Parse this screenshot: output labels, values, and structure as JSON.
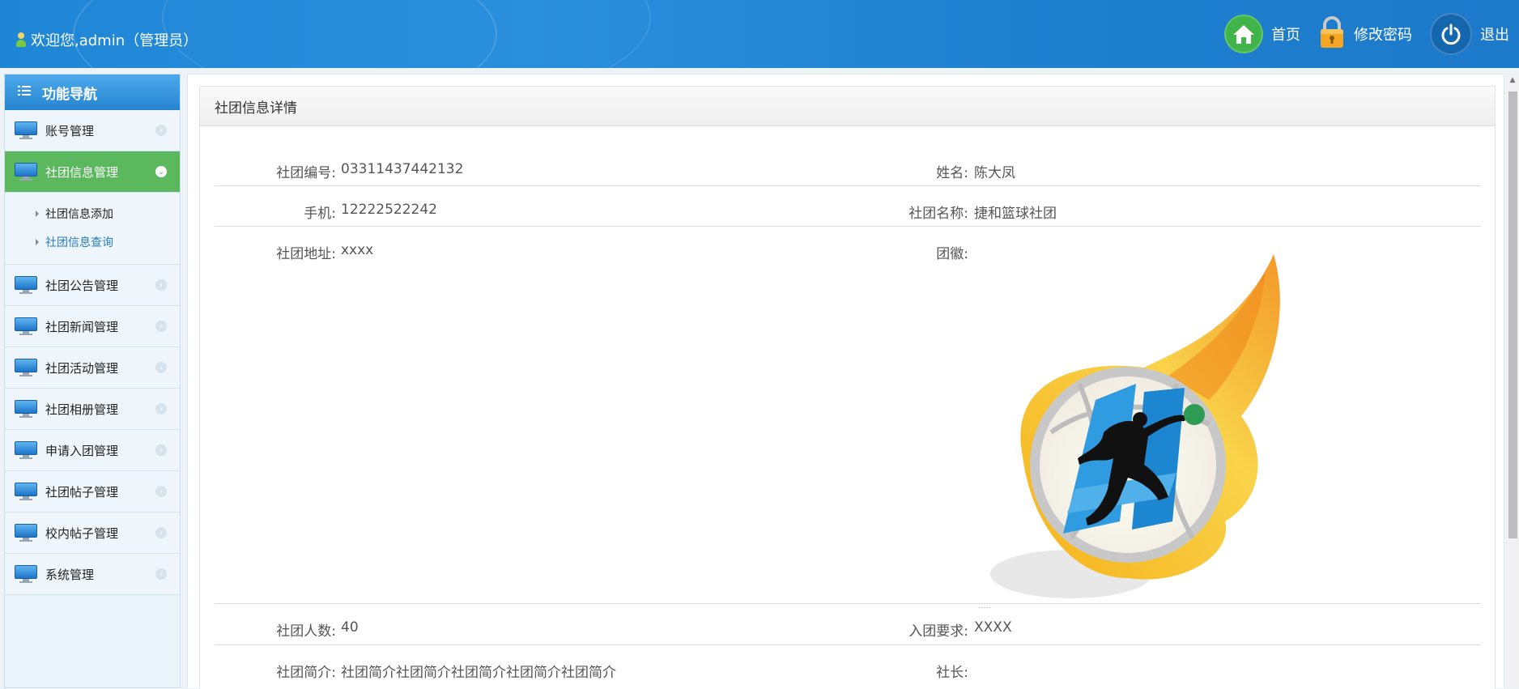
{
  "header": {
    "welcome": "欢迎您,admin（管理员）",
    "actions": {
      "home": "首页",
      "change_password": "修改密码",
      "logout": "退出"
    }
  },
  "sidebar": {
    "title": "功能导航",
    "items": [
      {
        "label": "账号管理"
      },
      {
        "label": "社团信息管理",
        "sub": [
          "社团信息添加",
          "社团信息查询"
        ]
      },
      {
        "label": "社团公告管理"
      },
      {
        "label": "社团新闻管理"
      },
      {
        "label": "社团活动管理"
      },
      {
        "label": "社团相册管理"
      },
      {
        "label": "申请入团管理"
      },
      {
        "label": "社团帖子管理"
      },
      {
        "label": "校内帖子管理"
      },
      {
        "label": "系统管理"
      }
    ]
  },
  "panel": {
    "title": "社团信息详情",
    "fields": {
      "club_no_label": "社团编号:",
      "club_no": "03311437442132",
      "name_label": "姓名:",
      "name": "陈大凤",
      "phone_label": "手机:",
      "phone": "12222522242",
      "club_name_label": "社团名称:",
      "club_name": "捷和篮球社团",
      "address_label": "社团地址:",
      "address": "xxxx",
      "emblem_label": "团徽:",
      "members_label": "社团人数:",
      "members": "40",
      "requirement_label": "入团要求:",
      "requirement": "XXXX",
      "intro_label": "社团简介:",
      "intro": "社团简介社团简介社团简介社团简介社团简介",
      "leader_label": "社长:"
    }
  },
  "colors": {
    "header_blue": "#1f86d6",
    "active_green": "#5cb85c",
    "nav_blue": "#2585cf"
  }
}
